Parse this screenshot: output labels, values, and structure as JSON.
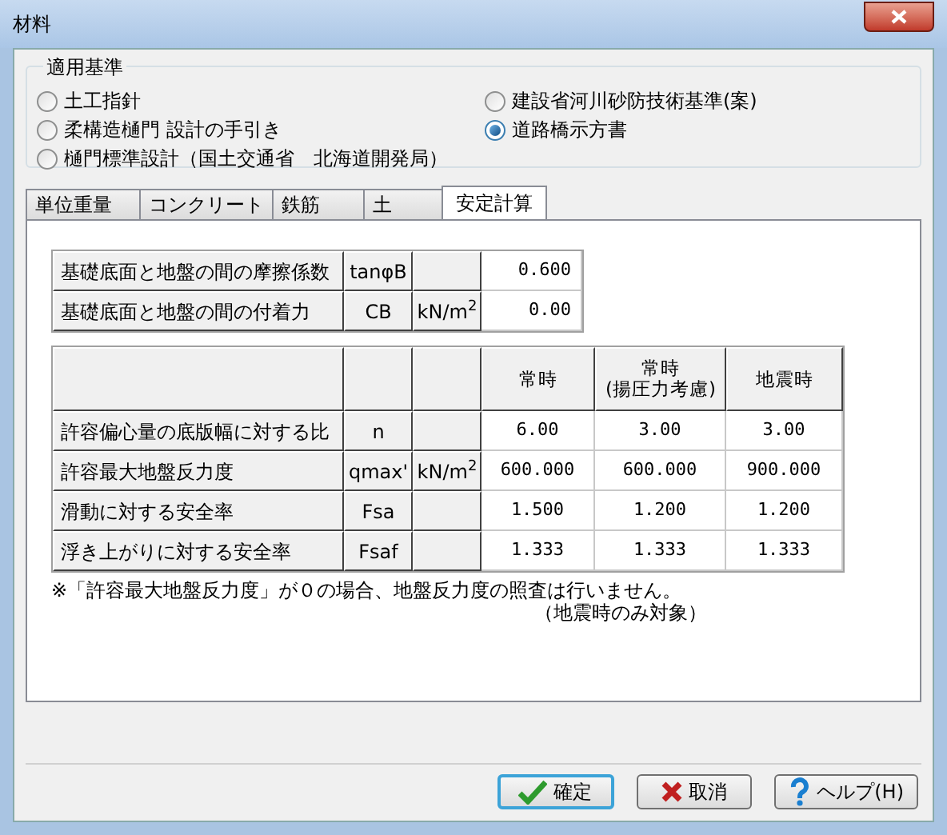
{
  "window": {
    "title": "材料"
  },
  "standard_group": {
    "title": "適用基準",
    "options": [
      {
        "label": "土工指針",
        "selected": false
      },
      {
        "label": "柔構造樋門 設計の手引き",
        "selected": false
      },
      {
        "label": "樋門標準設計（国土交通省　北海道開発局）",
        "selected": false
      },
      {
        "label": "建設省河川砂防技術基準(案)",
        "selected": false
      },
      {
        "label": "道路橋示方書",
        "selected": true
      }
    ]
  },
  "tabs": [
    {
      "label": "単位重量",
      "selected": false
    },
    {
      "label": "コンクリート",
      "selected": false
    },
    {
      "label": "鉄筋",
      "selected": false
    },
    {
      "label": "土",
      "selected": false
    },
    {
      "label": "安定計算",
      "selected": true
    }
  ],
  "base_table": {
    "rows": [
      {
        "label": "基礎底面と地盤の間の摩擦係数",
        "symbol": "tanφB",
        "unit": "",
        "value": "0.600"
      },
      {
        "label": "基礎底面と地盤の間の付着力",
        "symbol": "CB",
        "unit": "kN/m$^{2}$",
        "value": "0.00"
      }
    ]
  },
  "safety_table": {
    "columns": [
      "常時",
      "常時\n(揚圧力考慮)",
      "地震時"
    ],
    "rows": [
      {
        "label": "許容偏心量の底版幅に対する比",
        "symbol": "n",
        "unit": "",
        "values": [
          "6.00",
          "3.00",
          "3.00"
        ]
      },
      {
        "label": "許容最大地盤反力度",
        "symbol": "qmax'",
        "unit": "kN/m$^{2}$",
        "values": [
          "600.000",
          "600.000",
          "900.000"
        ]
      },
      {
        "label": "滑動に対する安全率",
        "symbol": "Fsa",
        "unit": "",
        "values": [
          "1.500",
          "1.200",
          "1.200"
        ]
      },
      {
        "label": "浮き上がりに対する安全率",
        "symbol": "Fsaf",
        "unit": "",
        "values": [
          "1.333",
          "1.333",
          "1.333"
        ]
      }
    ]
  },
  "note": [
    "※「許容最大地盤反力度」が０の場合、地盤反力度の照査は行いません。",
    "（地震時のみ対象）"
  ],
  "buttons": [
    {
      "kind": "ok",
      "label": "確定",
      "default": true
    },
    {
      "kind": "cancel",
      "label": "取消",
      "default": false
    },
    {
      "kind": "help",
      "label": "ヘルプ(H)",
      "default": false
    }
  ]
}
